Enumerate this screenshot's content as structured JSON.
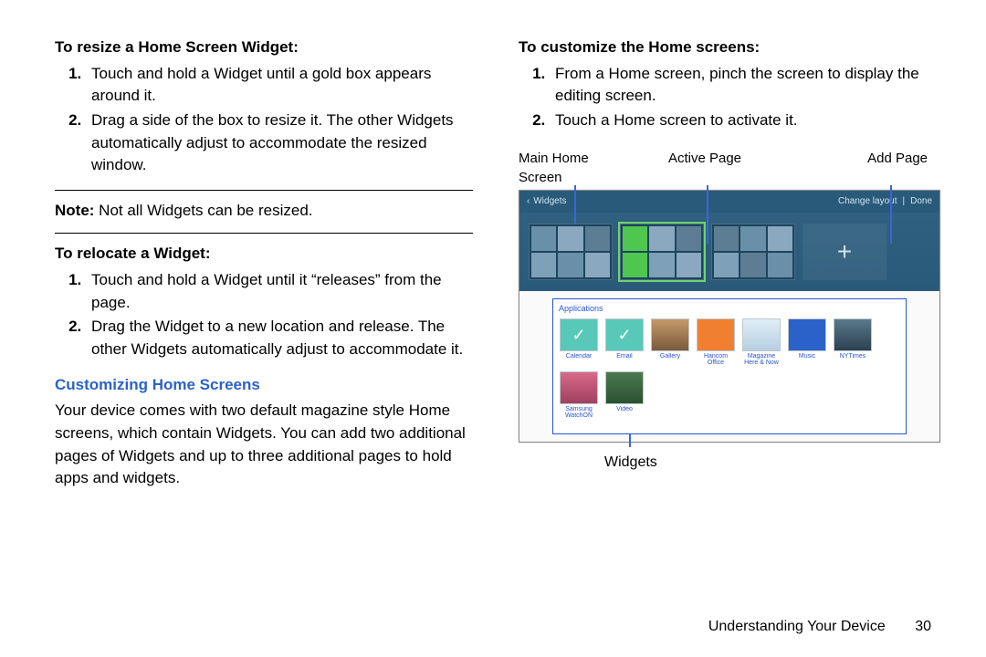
{
  "left": {
    "h_resize": "To resize a Home Screen Widget:",
    "resize_steps": [
      "Touch and hold a Widget until a gold box appears around it.",
      "Drag a side of the box to resize it. The other Widgets automatically adjust to accommodate the resized window."
    ],
    "note_label": "Note:",
    "note_text": " Not all Widgets can be resized.",
    "h_relocate": "To relocate a Widget:",
    "relocate_steps": [
      "Touch and hold a Widget until it “releases” from the page.",
      "Drag the Widget to a new location and release. The other Widgets automatically adjust to accommodate it."
    ],
    "h_custom": "Customizing Home Screens",
    "custom_para": "Your device comes with two default magazine style Home screens, which contain Widgets. You can add two additional pages of Widgets and up to three additional pages to hold apps and widgets."
  },
  "right": {
    "h_customize": "To customize the Home screens:",
    "customize_steps": [
      "From a Home screen, pinch the screen to display the editing screen.",
      "Touch a Home screen to activate it."
    ],
    "labels": {
      "main": "Main Home Screen",
      "active": "Active Page",
      "add": "Add Page",
      "widgets": "Widgets"
    },
    "topbar": {
      "back": "Widgets",
      "change": "Change layout",
      "done": "Done"
    },
    "apps_title": "Applications",
    "apps": [
      "Calendar",
      "Email",
      "Gallery",
      "Hancom Office",
      "Magazine Here & Now",
      "Music",
      "NYTimes",
      "Samsung WatchON",
      "Video"
    ]
  },
  "footer": {
    "chapter": "Understanding Your Device",
    "page": "30"
  }
}
